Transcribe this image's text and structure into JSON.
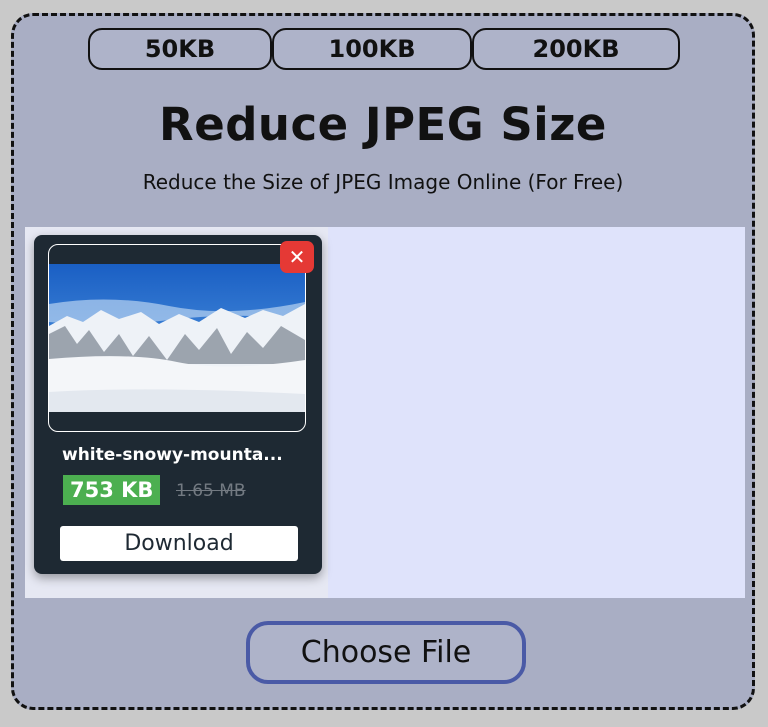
{
  "presets": [
    "50KB",
    "100KB",
    "200KB"
  ],
  "title": "Reduce JPEG Size",
  "subtitle": "Reduce the Size of JPEG Image Online (For Free)",
  "file": {
    "name": "white-snowy-mounta...",
    "new_size": "753 KB",
    "original_size": "1.65 MB",
    "download_label": "Download",
    "close_icon": "close-icon",
    "close_symbol": "✕"
  },
  "choose_file_label": "Choose File",
  "colors": {
    "page_bg": "#a9aec4",
    "dropzone_bg": "#dfe3fb",
    "card_bg": "#1e2933",
    "close_red": "#e53935",
    "size_green": "#4caf50",
    "choose_border": "#4a5aa6"
  }
}
